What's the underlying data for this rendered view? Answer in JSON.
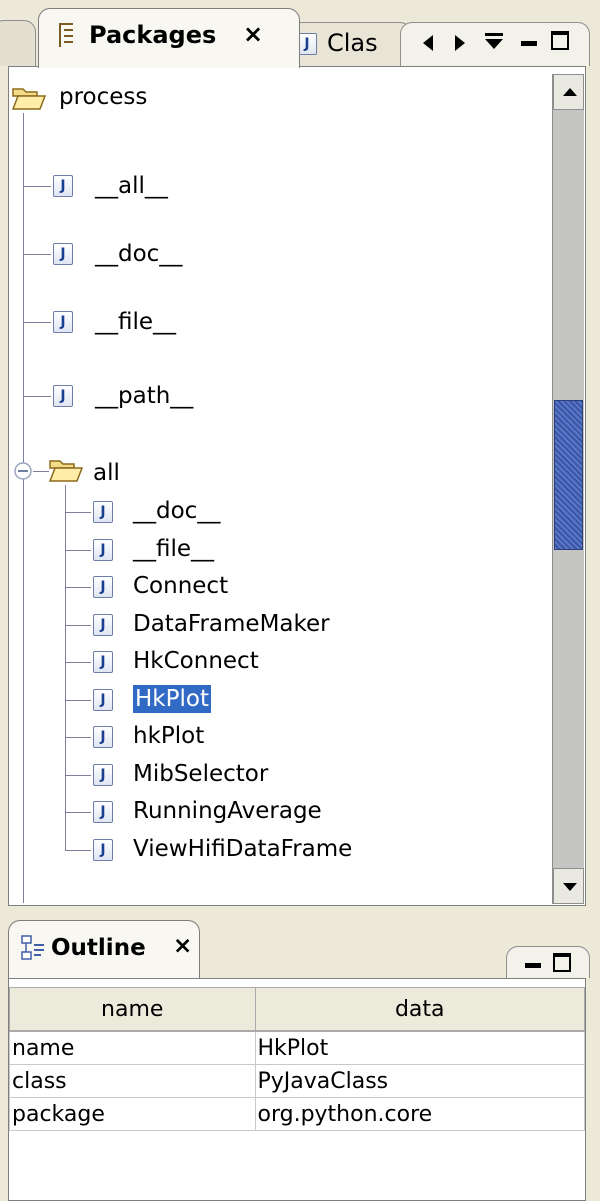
{
  "tabs": {
    "packages": {
      "label": "Packages",
      "close": "×",
      "icon": "package-icon"
    },
    "class": {
      "label": "Clas",
      "icon": "java-class-icon"
    }
  },
  "view_controls": {
    "prev": "◀",
    "next": "▶",
    "menu": "⯆",
    "minimize": "▬",
    "maximize": "□"
  },
  "tree": {
    "root": {
      "label": "process",
      "icon": "folder-open-icon"
    },
    "root_items": [
      {
        "label": "__all__",
        "icon": "java-class-icon"
      },
      {
        "label": "__doc__",
        "icon": "java-class-icon"
      },
      {
        "label": "__file__",
        "icon": "java-class-icon"
      },
      {
        "label": "__path__",
        "icon": "java-class-icon"
      }
    ],
    "all_node": {
      "label": "all",
      "icon": "folder-open-icon",
      "expanded": true
    },
    "all_items": [
      {
        "label": "__doc__",
        "selected": false
      },
      {
        "label": "__file__",
        "selected": false
      },
      {
        "label": "Connect",
        "selected": false
      },
      {
        "label": "DataFrameMaker",
        "selected": false
      },
      {
        "label": "HkConnect",
        "selected": false
      },
      {
        "label": "HkPlot",
        "selected": true
      },
      {
        "label": "hkPlot",
        "selected": false
      },
      {
        "label": "MibSelector",
        "selected": false
      },
      {
        "label": "RunningAverage",
        "selected": false
      },
      {
        "label": "ViewHifiDataFrame",
        "selected": false
      }
    ]
  },
  "outline": {
    "tab_label": "Outline",
    "close": "×",
    "icon": "outline-icon",
    "columns": [
      "name",
      "data"
    ],
    "rows": [
      [
        "name",
        "HkPlot"
      ],
      [
        "class",
        "PyJavaClass"
      ],
      [
        "package",
        "org.python.core"
      ]
    ]
  },
  "colors": {
    "selection": "#316ac5",
    "thumb": "#4a67b6",
    "chrome": "#ece9d8"
  }
}
